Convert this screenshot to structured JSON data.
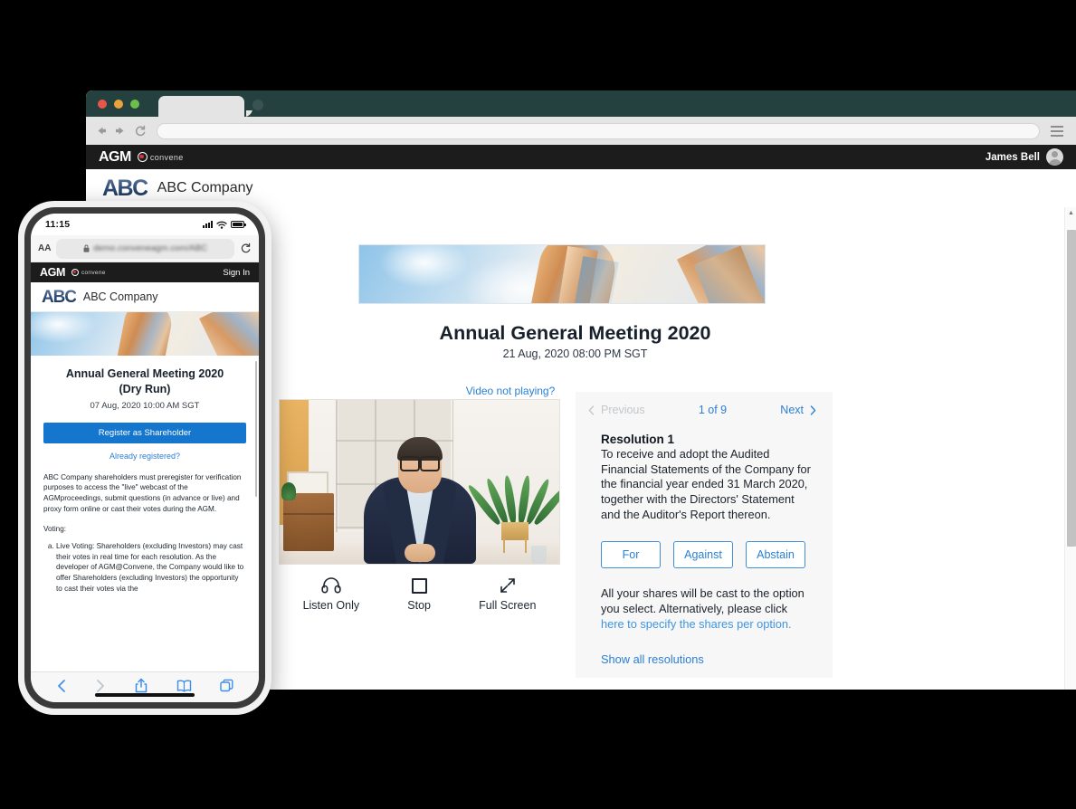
{
  "browser": {
    "traffic_lights": [
      "close",
      "minimize",
      "maximize"
    ],
    "back_icon": "◀",
    "forward_icon": "▶",
    "reload_icon": "⟳",
    "url_value": "",
    "url_placeholder": ""
  },
  "appbar": {
    "logo_word": "AGM",
    "convene_text": "convene",
    "user_name": "James Bell"
  },
  "company": {
    "logo_text": "ABC",
    "name": "ABC Company"
  },
  "meeting": {
    "title": "Annual General Meeting 2020",
    "datetime": "21 Aug, 2020 08:00 PM SGT",
    "video_not_playing": "Video not playing?"
  },
  "controls": [
    {
      "label": "Listen Only",
      "icon": "headphones-icon"
    },
    {
      "label": "Stop",
      "icon": "stop-icon"
    },
    {
      "label": "Full Screen",
      "icon": "fullscreen-icon"
    }
  ],
  "resolution": {
    "previous_label": "Previous",
    "counter": "1 of 9",
    "next_label": "Next",
    "title": "Resolution 1",
    "text": "To receive and adopt the Audited Financial Statements of the Company for the financial year ended 31 March 2020, together with the Directors' Statement and the Auditor's Report thereon.",
    "vote_buttons": [
      "For",
      "Against",
      "Abstain"
    ],
    "note_line1": "All your shares will be cast to the option",
    "note_line2": "you select. Alternatively, please click",
    "note_link": "here to specify the shares per option.",
    "show_all": "Show all resolutions",
    "accent_color": "#2a7fd4",
    "panel_bg": "#f7f7f7"
  },
  "phone": {
    "status": {
      "time": "11:15",
      "signal": "signal-icon",
      "wifi": "wifi-icon",
      "battery": "battery-icon"
    },
    "safari": {
      "aa_label": "AA",
      "lock_icon": "lock-icon",
      "url": "demo.conveneagm.com/ABC",
      "reload_icon": "⟳",
      "toolbar": [
        "back-icon",
        "forward-icon",
        "share-icon",
        "bookmarks-icon",
        "tabs-icon"
      ]
    },
    "appbar": {
      "logo_word": "AGM",
      "convene_text": "convene",
      "signin_label": "Sign In"
    },
    "company": {
      "logo_text": "ABC",
      "name": "ABC Company"
    },
    "meeting": {
      "title_line1": "Annual General Meeting 2020",
      "title_line2": "(Dry Run)",
      "datetime": "07 Aug, 2020 10:00 AM SGT"
    },
    "register_button": "Register as Shareholder",
    "already_registered": "Already registered?",
    "paragraph": "ABC Company shareholders must preregister for verification purposes to access the \"live\" webcast of the AGMproceedings, submit questions (in advance or live) and proxy form online or cast their votes during the AGM.",
    "voting_label": "Voting:",
    "list_items": [
      "Live Voting: Shareholders (excluding Investors) may cast their votes in real time for each resolution. As the developer of AGM@Convene, the Company would like to offer Shareholders (excluding Investors) the opportunity to cast their votes via the"
    ],
    "button_color": "#1476cd"
  }
}
